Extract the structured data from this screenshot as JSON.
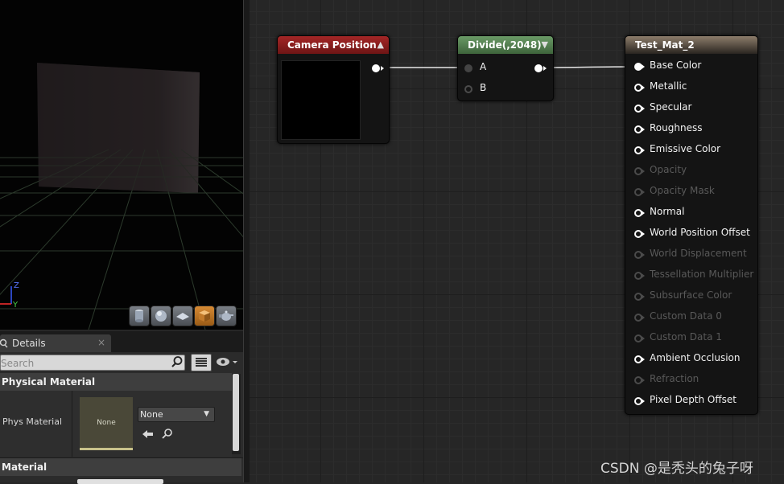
{
  "viewport": {
    "toolbar_icons": [
      "cylinder-icon",
      "sphere-icon",
      "plane-icon",
      "cube-icon",
      "teapot-icon"
    ],
    "active_index": 3,
    "axis": {
      "z": "Z",
      "y": "Y"
    }
  },
  "details": {
    "tab_label": "Details",
    "tab_close": "×",
    "search_placeholder": "Search",
    "sections": {
      "physical_material": "Physical Material",
      "material": "Material"
    },
    "phys_material": {
      "label": "Phys Material",
      "thumbnail_text": "None",
      "value": "None"
    }
  },
  "graph": {
    "nodes": {
      "camera_position": {
        "title": "Camera Position",
        "header_color": "#8b1a1a",
        "collapse": "▲"
      },
      "divide": {
        "title": "Divide(,2048)",
        "header_color": "#4f7a4c",
        "collapse": "▼",
        "inputs": [
          "A",
          "B"
        ]
      },
      "result": {
        "title": "Test_Mat_2",
        "header_color": "#7a6a58",
        "inputs": [
          {
            "label": "Base Color",
            "enabled": true,
            "connected": true
          },
          {
            "label": "Metallic",
            "enabled": true,
            "connected": false
          },
          {
            "label": "Specular",
            "enabled": true,
            "connected": false
          },
          {
            "label": "Roughness",
            "enabled": true,
            "connected": false
          },
          {
            "label": "Emissive Color",
            "enabled": true,
            "connected": false
          },
          {
            "label": "Opacity",
            "enabled": false,
            "connected": false
          },
          {
            "label": "Opacity Mask",
            "enabled": false,
            "connected": false
          },
          {
            "label": "Normal",
            "enabled": true,
            "connected": false
          },
          {
            "label": "World Position Offset",
            "enabled": true,
            "connected": false
          },
          {
            "label": "World Displacement",
            "enabled": false,
            "connected": false
          },
          {
            "label": "Tessellation Multiplier",
            "enabled": false,
            "connected": false
          },
          {
            "label": "Subsurface Color",
            "enabled": false,
            "connected": false
          },
          {
            "label": "Custom Data 0",
            "enabled": false,
            "connected": false
          },
          {
            "label": "Custom Data 1",
            "enabled": false,
            "connected": false
          },
          {
            "label": "Ambient Occlusion",
            "enabled": true,
            "connected": false
          },
          {
            "label": "Refraction",
            "enabled": false,
            "connected": false
          },
          {
            "label": "Pixel Depth Offset",
            "enabled": true,
            "connected": false
          }
        ]
      }
    }
  },
  "watermark": "CSDN @是秃头的兔子呀"
}
